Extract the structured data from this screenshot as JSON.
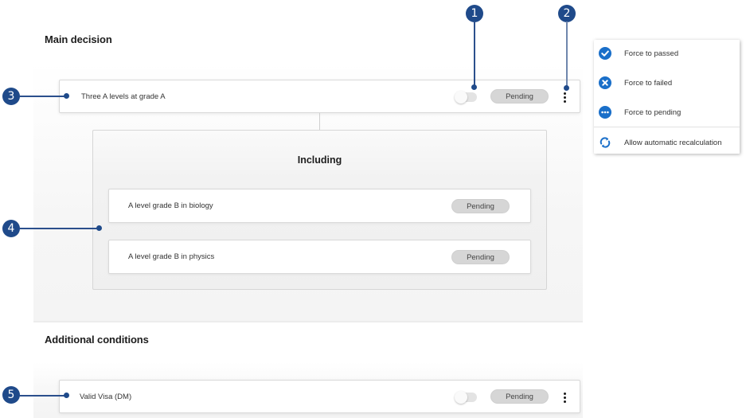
{
  "main_decision": {
    "title": "Main decision",
    "card": {
      "label": "Three A levels at grade A",
      "status": "Pending",
      "toggle_on": false
    },
    "group": {
      "title": "Including",
      "items": [
        {
          "label": "A level grade B in biology",
          "status": "Pending"
        },
        {
          "label": "A level grade B in physics",
          "status": "Pending"
        }
      ]
    }
  },
  "additional_conditions": {
    "title": "Additional conditions",
    "card": {
      "label": "Valid Visa (DM)",
      "status": "Pending",
      "toggle_on": false
    }
  },
  "context_menu": {
    "items": [
      {
        "label": "Force to passed",
        "icon": "check-circle-icon"
      },
      {
        "label": "Force to failed",
        "icon": "x-circle-icon"
      },
      {
        "label": "Force to pending",
        "icon": "ellipsis-circle-icon"
      },
      {
        "label": "Allow automatic recalculation",
        "icon": "refresh-icon"
      }
    ]
  },
  "callouts": [
    "1",
    "2",
    "3",
    "4",
    "5"
  ],
  "colors": {
    "callout": "#1f4a8a",
    "menu_icon": "#1a6fc9",
    "pending_badge": "#d6d6d6"
  }
}
